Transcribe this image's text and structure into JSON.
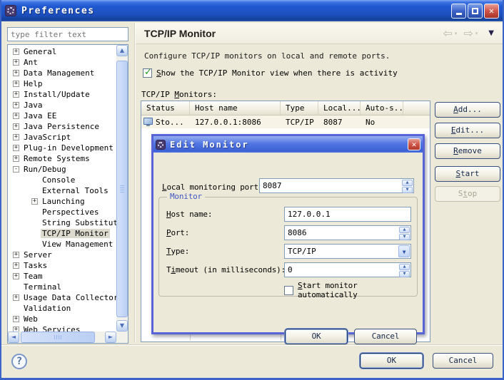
{
  "window": {
    "title": "Preferences",
    "help_icon": "?",
    "ok_label": "OK",
    "cancel_label": "Cancel"
  },
  "icons": {
    "close": "✕",
    "check": "✓",
    "back": "⇦",
    "forward": "⇨",
    "dropdown": "▾",
    "menu": "▼",
    "spin_up": "▲",
    "spin_down": "▼",
    "combo_arrow": "▼",
    "scroll_up": "▲",
    "scroll_down": "▼",
    "scroll_left": "◄",
    "scroll_right": "►"
  },
  "sidebar": {
    "filter_placeholder": "type filter text",
    "tree": [
      {
        "label": "General",
        "expand": "+",
        "level": 0
      },
      {
        "label": "Ant",
        "expand": "+",
        "level": 0
      },
      {
        "label": "Data Management",
        "expand": "+",
        "level": 0
      },
      {
        "label": "Help",
        "expand": "+",
        "level": 0
      },
      {
        "label": "Install/Update",
        "expand": "+",
        "level": 0
      },
      {
        "label": "Java",
        "expand": "+",
        "level": 0
      },
      {
        "label": "Java EE",
        "expand": "+",
        "level": 0
      },
      {
        "label": "Java Persistence",
        "expand": "+",
        "level": 0
      },
      {
        "label": "JavaScript",
        "expand": "+",
        "level": 0
      },
      {
        "label": "Plug-in Development",
        "expand": "+",
        "level": 0
      },
      {
        "label": "Remote Systems",
        "expand": "+",
        "level": 0
      },
      {
        "label": "Run/Debug",
        "expand": "-",
        "level": 0
      },
      {
        "label": "Console",
        "expand": "",
        "level": 1
      },
      {
        "label": "External Tools",
        "expand": "",
        "level": 1
      },
      {
        "label": "Launching",
        "expand": "+",
        "level": 1
      },
      {
        "label": "Perspectives",
        "expand": "",
        "level": 1
      },
      {
        "label": "String Substitution",
        "expand": "",
        "level": 1
      },
      {
        "label": "TCP/IP Monitor",
        "expand": "",
        "level": 1,
        "selected": true
      },
      {
        "label": "View Management",
        "expand": "",
        "level": 1
      },
      {
        "label": "Server",
        "expand": "+",
        "level": 0
      },
      {
        "label": "Tasks",
        "expand": "+",
        "level": 0
      },
      {
        "label": "Team",
        "expand": "+",
        "level": 0
      },
      {
        "label": "Terminal",
        "expand": "",
        "level": 0
      },
      {
        "label": "Usage Data Collector",
        "expand": "+",
        "level": 0
      },
      {
        "label": "Validation",
        "expand": "",
        "level": 0
      },
      {
        "label": "Web",
        "expand": "+",
        "level": 0
      },
      {
        "label": "Web Services",
        "expand": "+",
        "level": 0
      }
    ]
  },
  "content": {
    "page_title": "TCP/IP Monitor",
    "description": "Configure TCP/IP monitors on local and remote ports.",
    "show_view_checkbox_label": "&Show the TCP/IP Monitor view when there is activity",
    "show_view_checked": true,
    "monitors_label": "TCP/IP &Monitors:",
    "table": {
      "columns": [
        "Status",
        "Host name",
        "Type",
        "Local...",
        "Auto-s..."
      ],
      "rows": [
        {
          "status": "Sto...",
          "host": "127.0.0.1:8086",
          "type": "TCP/IP",
          "local": "8087",
          "auto": "No"
        }
      ]
    },
    "actions": {
      "add": "&Add...",
      "edit": "&Edit...",
      "remove": "&Remove",
      "start": "&Start",
      "stop": "S&top"
    }
  },
  "dialog": {
    "title": "Edit Monitor",
    "local_port_label": "&Local monitoring port:",
    "local_port_value": "8087",
    "group_title": "Monitor",
    "host_label": "&Host name:",
    "host_value": "127.0.0.1",
    "port_label": "&Port:",
    "port_value": "8086",
    "type_label": "&Type:",
    "type_value": "TCP/IP",
    "timeout_label": "T&imeout (in milliseconds):",
    "timeout_value": "0",
    "auto_start_label": "&Start monitor automatically",
    "auto_start_checked": false,
    "ok_label": "OK",
    "cancel_label": "Cancel"
  },
  "colors": {
    "titlebar_blue": "#2058D0",
    "window_border": "#3A64C8",
    "background_beige": "#ECE9D8",
    "dialog_border": "#5863D8",
    "selection_gray": "#DCD9CE",
    "check_green": "#1FA11F",
    "group_legend_blue": "#4257C8",
    "close_red": "#CE5448",
    "field_border": "#7F9DB9"
  }
}
